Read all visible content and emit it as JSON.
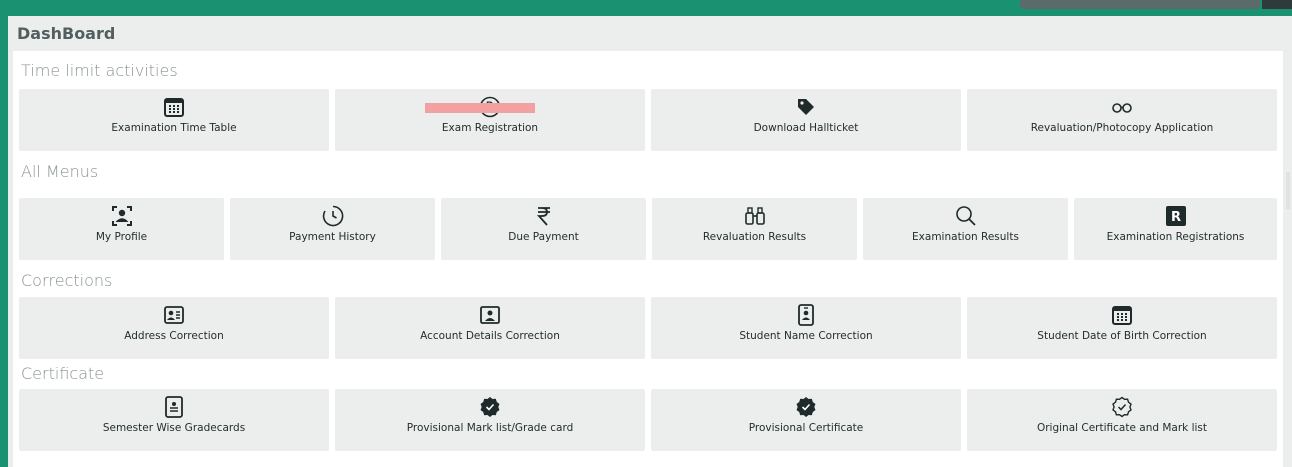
{
  "header": {
    "title": "DashBoard"
  },
  "sections": {
    "time_limit": {
      "title": "Time limit activities",
      "tiles": [
        {
          "label": "Examination Time Table",
          "icon": "calendar-grid-icon"
        },
        {
          "label": "Exam Registration",
          "icon": "registered-icon"
        },
        {
          "label": "Download Hallticket",
          "icon": "tag-icon"
        },
        {
          "label": "Revaluation/Photocopy Application",
          "icon": "glasses-icon"
        }
      ]
    },
    "all_menus": {
      "title": "All Menus",
      "tiles": [
        {
          "label": "My Profile",
          "icon": "user-frame-icon"
        },
        {
          "label": "Payment History",
          "icon": "clock-history-icon"
        },
        {
          "label": "Due Payment",
          "icon": "rupee-icon"
        },
        {
          "label": "Revaluation Results",
          "icon": "binoculars-icon"
        },
        {
          "label": "Examination Results",
          "icon": "search-icon"
        },
        {
          "label": "Examination Registrations",
          "icon": "r-square-icon"
        }
      ]
    },
    "corrections": {
      "title": "Corrections",
      "tiles": [
        {
          "label": "Address Correction",
          "icon": "id-card-icon"
        },
        {
          "label": "Account Details Correction",
          "icon": "portrait-card-icon"
        },
        {
          "label": "Student Name Correction",
          "icon": "badge-icon"
        },
        {
          "label": "Student Date of Birth Correction",
          "icon": "calendar-grid-icon"
        }
      ]
    },
    "certificate": {
      "title": "Certificate",
      "tiles": [
        {
          "label": "Semester Wise Gradecards",
          "icon": "document-icon"
        },
        {
          "label": "Provisional Mark list/Grade card",
          "icon": "verified-badge-icon"
        },
        {
          "label": "Provisional Certificate",
          "icon": "verified-badge-icon"
        },
        {
          "label": "Original Certificate and Mark list",
          "icon": "verified-outline-icon"
        }
      ]
    }
  },
  "colors": {
    "frame": "#1a9170",
    "tile_bg": "#eceeee",
    "icon": "#1f2b2a",
    "highlight": "#f2a0a0"
  }
}
